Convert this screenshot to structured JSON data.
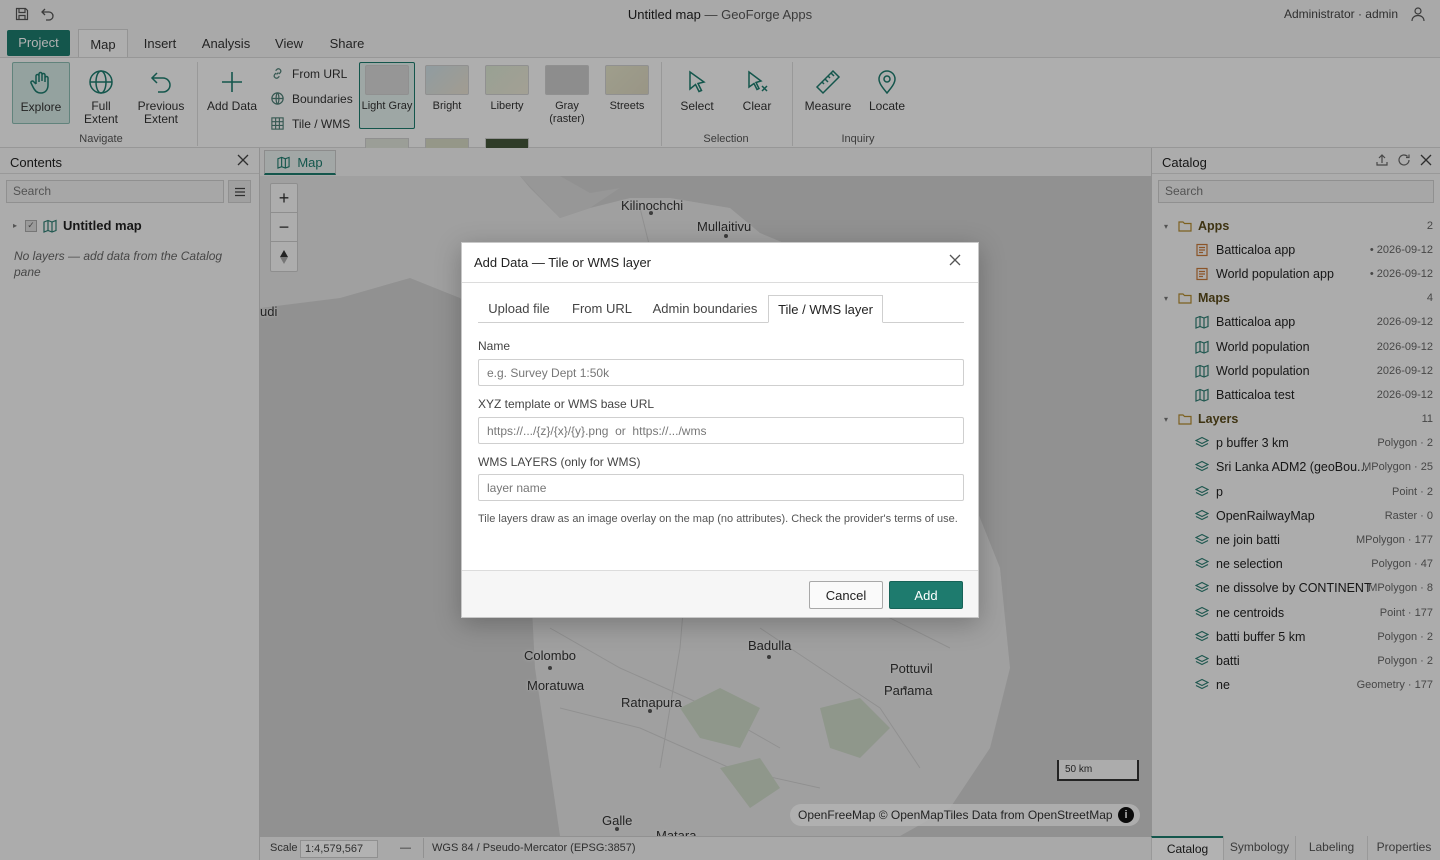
{
  "titlebar": {
    "title": "Untitled map",
    "subtitle": "— GeoForge Apps",
    "user": "Administrator · admin",
    "save_icon": "save-icon",
    "undo_icon": "undo-icon",
    "user_icon": "user-icon"
  },
  "ribbon_tabs": [
    "Project",
    "Map",
    "Insert",
    "Analysis",
    "View",
    "Share"
  ],
  "ribbon": {
    "navigate": {
      "label": "Navigate",
      "explore": "Explore",
      "full_extent": [
        "Full",
        "Extent"
      ],
      "previous_extent": [
        "Previous",
        "Extent"
      ]
    },
    "add_data": "Add Data",
    "from_url": "From URL",
    "boundaries": "Boundaries",
    "tile_wms": "Tile / WMS",
    "basemaps": [
      {
        "label": "Light Gray",
        "color": "#d7d7d7",
        "selected": true
      },
      {
        "label": "Bright",
        "color": "#cfe0e6"
      },
      {
        "label": "Liberty",
        "color": "#dbe7d3"
      },
      {
        "label": "Gray (raster)",
        "label_lines": [
          "Gray",
          "(raster)"
        ],
        "color": "#cbcbcb"
      },
      {
        "label": "Streets",
        "color": "#e3e3c9"
      }
    ],
    "selection": {
      "label": "Selection",
      "select": "Select",
      "clear": "Clear"
    },
    "inquiry": {
      "label": "Inquiry",
      "measure": "Measure",
      "locate": "Locate"
    }
  },
  "contents": {
    "title": "Contents",
    "search_placeholder": "Search",
    "map_name": "Untitled map",
    "empty_hint": "No layers — add data from the Catalog pane"
  },
  "map": {
    "tab": "Map",
    "places": [
      "Kilinochchi",
      "Mullaitivu",
      "udi",
      "Colombo",
      "Moratuwa",
      "Ratnapura",
      "Badulla",
      "Pottuvil",
      "Panama",
      "Galle",
      "Matara"
    ],
    "scale_bar": "50 km",
    "attribution": "OpenFreeMap © OpenMapTiles Data from OpenStreetMap"
  },
  "statusbar": {
    "scale_label": "Scale",
    "scale_value": "1:4,579,567",
    "dash": "—",
    "crs": "WGS 84 / Pseudo-Mercator (EPSG:3857)"
  },
  "catalog": {
    "title": "Catalog",
    "search_placeholder": "Search",
    "groups": [
      {
        "name": "Apps",
        "count": "2",
        "items": [
          {
            "name": "Batticaloa app",
            "meta": "• 2026-09-12"
          },
          {
            "name": "World population app",
            "meta": "• 2026-09-12"
          }
        ]
      },
      {
        "name": "Maps",
        "count": "4",
        "items": [
          {
            "name": "Batticaloa app",
            "meta": "2026-09-12"
          },
          {
            "name": "World population",
            "meta": "2026-09-12"
          },
          {
            "name": "World population",
            "meta": "2026-09-12"
          },
          {
            "name": "Batticaloa test",
            "meta": "2026-09-12"
          }
        ]
      },
      {
        "name": "Layers",
        "count": "11",
        "items": [
          {
            "name": "p buffer 3 km",
            "meta": "Polygon · 2"
          },
          {
            "name": "Sri Lanka ADM2 (geoBou...",
            "meta": "MPolygon · 25"
          },
          {
            "name": "p",
            "meta": "Point · 2"
          },
          {
            "name": "OpenRailwayMap",
            "meta": "Raster · 0"
          },
          {
            "name": "ne join batti",
            "meta": "MPolygon · 177"
          },
          {
            "name": "ne selection",
            "meta": "Polygon · 47"
          },
          {
            "name": "ne dissolve by CONTINENT",
            "meta": "MPolygon · 8"
          },
          {
            "name": "ne centroids",
            "meta": "Point · 177"
          },
          {
            "name": "batti buffer 5 km",
            "meta": "Polygon · 2"
          },
          {
            "name": "batti",
            "meta": "Polygon · 2"
          },
          {
            "name": "ne",
            "meta": "Geometry · 177"
          }
        ]
      }
    ],
    "bottom_tabs": [
      "Catalog",
      "Symbology",
      "Labeling",
      "Properties"
    ]
  },
  "dialog": {
    "title": "Add Data — Tile or WMS layer",
    "tabs": [
      "Upload file",
      "From URL",
      "Admin boundaries",
      "Tile / WMS layer"
    ],
    "name_label": "Name",
    "name_placeholder": "e.g. Survey Dept 1:50k",
    "url_label": "XYZ template or WMS base URL",
    "url_placeholder": "https://.../{z}/{x}/{y}.png  or  https://.../wms",
    "layers_label": "WMS LAYERS (only for WMS)",
    "layers_placeholder": "layer name",
    "hint": "Tile layers draw as an image overlay on the map (no attributes). Check the provider's terms of use.",
    "cancel": "Cancel",
    "add": "Add"
  },
  "colors": {
    "accent": "#1e7b6e",
    "folder": "#b38b2e",
    "app": "#c8793a"
  }
}
